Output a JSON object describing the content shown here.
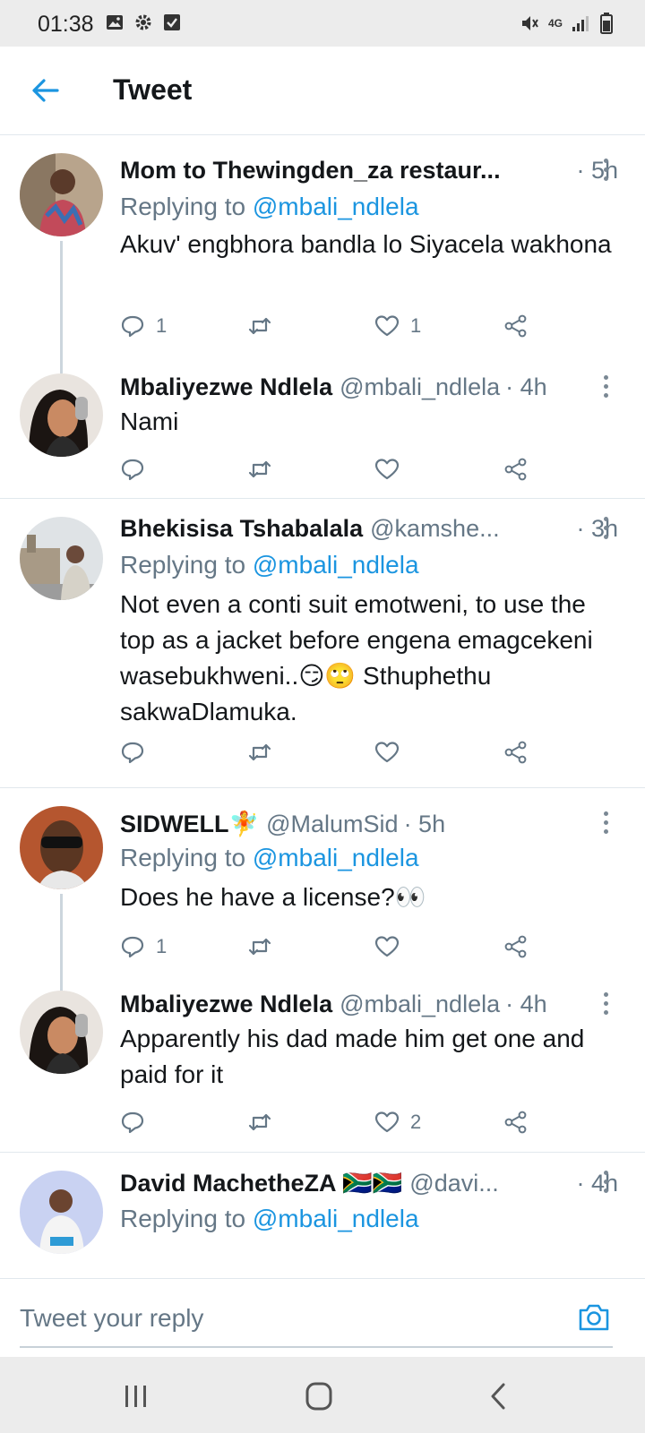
{
  "status_bar": {
    "time": "01:38",
    "network": "4G"
  },
  "header": {
    "title": "Tweet",
    "back_icon": "arrow-left-icon"
  },
  "colors": {
    "accent": "#1b95e0",
    "secondary_text": "#657786",
    "divider": "#e1e8ed"
  },
  "tweets": [
    {
      "name": "Mom to Thewingden_za restaur...",
      "handle": "",
      "time": "· 5h",
      "replying_prefix": "Replying to",
      "replying_to": "@mbali_ndlela",
      "text": "Akuv' engbhora bandla lo Siyacela wakhona",
      "replies": "1",
      "retweets": "",
      "likes": "1"
    },
    {
      "name": "Mbaliyezwe Ndlela",
      "handle": "@mbali_ndlela",
      "time": "· 4h",
      "text": "Nami",
      "replies": "",
      "retweets": "",
      "likes": ""
    },
    {
      "name": "Bhekisisa Tshabalala",
      "handle": "@kamshe...",
      "time": "· 3h",
      "replying_prefix": "Replying to",
      "replying_to": "@mbali_ndlela",
      "text": "Not even a conti suit emotweni, to use the top as a jacket before engena emagcekeni wasebukhweni..😏🙄 Sthuphethu sakwaDlamuka.",
      "replies": "",
      "retweets": "",
      "likes": ""
    },
    {
      "name": "SIDWELL🧚",
      "handle": "@MalumSid",
      "time": "· 5h",
      "replying_prefix": "Replying to",
      "replying_to": "@mbali_ndlela",
      "text": "Does he have a license?👀",
      "replies": "1",
      "retweets": "",
      "likes": ""
    },
    {
      "name": "Mbaliyezwe Ndlela",
      "handle": "@mbali_ndlela",
      "time": "· 4h",
      "text": "Apparently his dad made him get one and paid for it",
      "replies": "",
      "retweets": "",
      "likes": "2"
    },
    {
      "name": "David MachetheZA 🇿🇦🇿🇦",
      "handle": "@davi...",
      "time": "· 4h",
      "replying_prefix": "Replying to",
      "replying_to": "@mbali_ndlela",
      "text": "",
      "replies": "",
      "retweets": "",
      "likes": ""
    }
  ],
  "composer": {
    "placeholder": "Tweet your reply",
    "camera_icon": "camera-icon"
  }
}
